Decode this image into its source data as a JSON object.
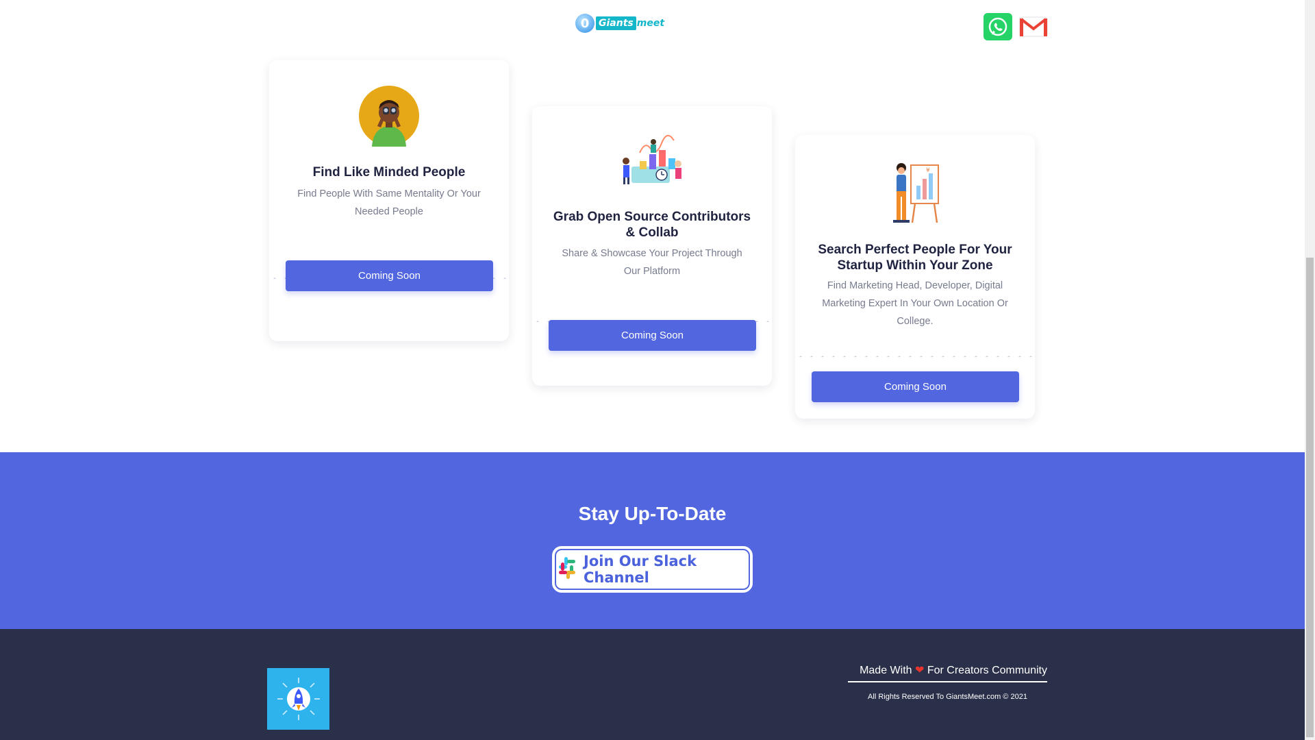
{
  "header": {
    "logo": {
      "mark": "0",
      "text_boxed": "Giants",
      "text_plain": "meet"
    },
    "contacts": [
      {
        "icon": "whatsapp-icon",
        "color": "#25d366"
      },
      {
        "icon": "gmail-icon",
        "color": "#ea4335"
      }
    ]
  },
  "cards": [
    {
      "icon": "binoculars-person-icon",
      "title": "Find Like Minded People",
      "description": "Find People With Same Mentality Or Your Needed People",
      "button_label": "Coming Soon"
    },
    {
      "icon": "collaboration-illustration-icon",
      "title": "Grab Open Source Contributors & Collab",
      "description": "Share & Showcase Your Project Through Our Platform",
      "button_label": "Coming Soon"
    },
    {
      "icon": "presentation-board-icon",
      "title": "Search Perfect People For Your Startup Within Your Zone",
      "description": "Find Marketing Head, Developer, Digital Marketing Expert In Your Own Location Or College.",
      "button_label": "Coming Soon"
    }
  ],
  "newsletter": {
    "title": "Stay Up-To-Date",
    "slack_button_label": "Join Our Slack Channel",
    "slack_icon": "slack-icon"
  },
  "footer": {
    "logo_icon": "rocket-icon",
    "made_with_prefix": "Made With",
    "heart": "❤",
    "made_with_suffix": "For Creators Community",
    "rights": "All Rights Reserved To GiantsMeet.com © 2021"
  },
  "colors": {
    "accent": "#5267df",
    "footer_bg": "#2a3049",
    "title": "#1f2340",
    "muted": "#767b8e"
  }
}
